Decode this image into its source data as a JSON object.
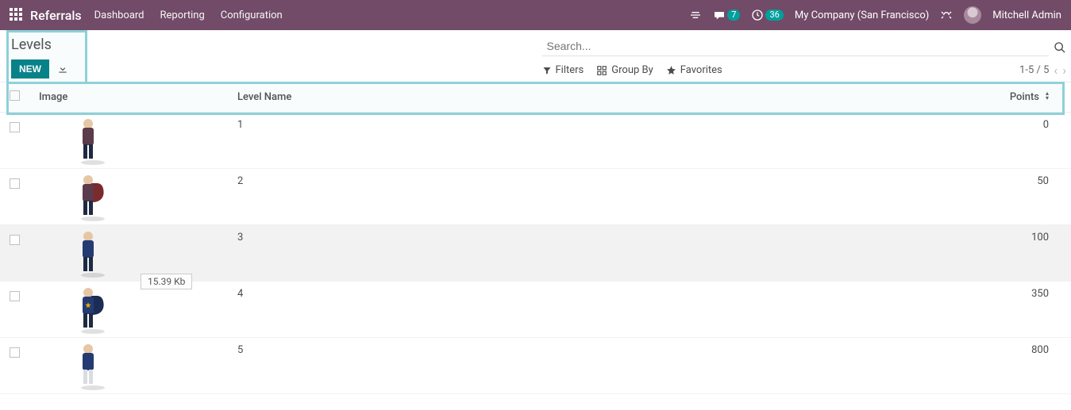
{
  "navbar": {
    "brand": "Referrals",
    "menu": [
      "Dashboard",
      "Reporting",
      "Configuration"
    ],
    "messages_count": "7",
    "activities_count": "36",
    "company": "My Company (San Francisco)",
    "user": "Mitchell Admin"
  },
  "page": {
    "title": "Levels",
    "new_label": "NEW",
    "search_placeholder": "Search..."
  },
  "toolbar": {
    "filters": "Filters",
    "group_by": "Group By",
    "favorites": "Favorites",
    "pager": "1-5 / 5"
  },
  "table": {
    "headers": {
      "image": "Image",
      "level_name": "Level Name",
      "points": "Points"
    },
    "rows": [
      {
        "level_name": "1",
        "points": "0"
      },
      {
        "level_name": "2",
        "points": "50"
      },
      {
        "level_name": "3",
        "points": "100"
      },
      {
        "level_name": "4",
        "points": "350"
      },
      {
        "level_name": "5",
        "points": "800"
      }
    ]
  },
  "tooltip": {
    "size": "15.39 Kb"
  }
}
